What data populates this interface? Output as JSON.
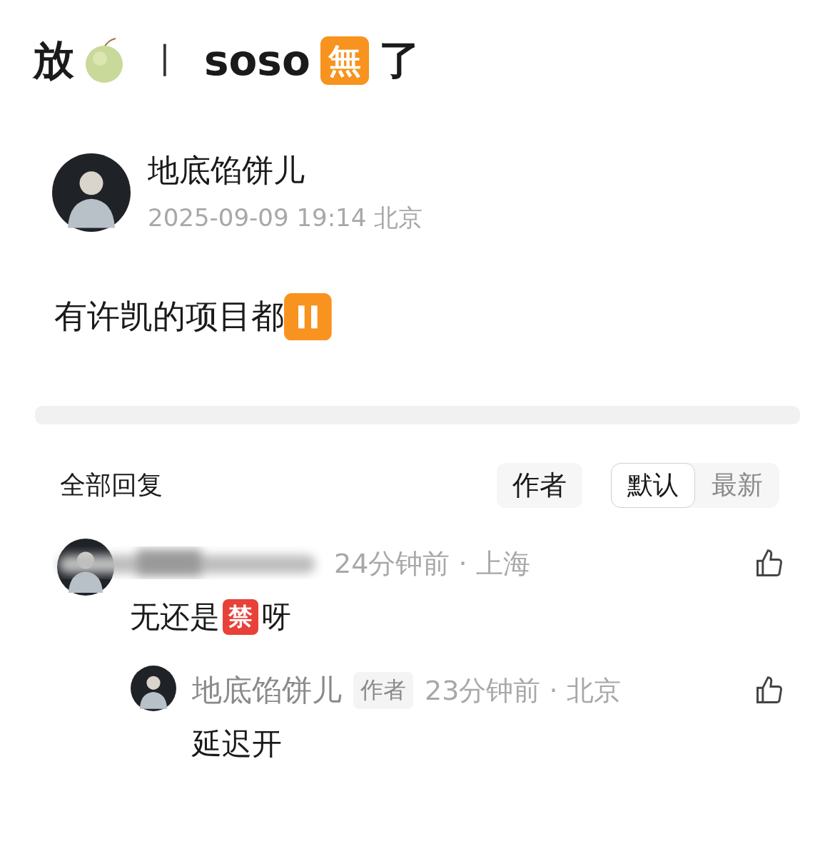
{
  "title": [
    {
      "kind": "text",
      "text": "放"
    },
    {
      "kind": "melon"
    },
    {
      "kind": "separator",
      "text": "丨"
    },
    {
      "kind": "text",
      "text": "soso"
    },
    {
      "kind": "badge",
      "text": "無",
      "color": "#f7931e"
    },
    {
      "kind": "text",
      "text": "了"
    }
  ],
  "post": {
    "author": "地底馅饼儿",
    "meta": "2025-09-09 19:14 北京",
    "body": [
      {
        "kind": "text",
        "text": "有许凯的项目都"
      },
      {
        "kind": "pause"
      }
    ]
  },
  "replies_header": {
    "title": "全部回复",
    "author_filter": {
      "label": "作者",
      "selected": false
    },
    "sort_tabs": [
      {
        "label": "默认",
        "selected": true
      },
      {
        "label": "最新",
        "selected": false
      }
    ]
  },
  "comments": [
    {
      "author_blurred": true,
      "meta": "24分钟前 · 上海",
      "body": [
        {
          "kind": "text",
          "text": "无还是"
        },
        {
          "kind": "badge",
          "text": "禁",
          "color": "#e8413a"
        },
        {
          "kind": "text",
          "text": "呀"
        }
      ],
      "kind": "comment"
    },
    {
      "author": "地底馅饼儿",
      "author_tag": "作者",
      "meta": "23分钟前 · 北京",
      "body": [
        {
          "kind": "text",
          "text": "延迟开"
        }
      ],
      "kind": "reply"
    }
  ]
}
